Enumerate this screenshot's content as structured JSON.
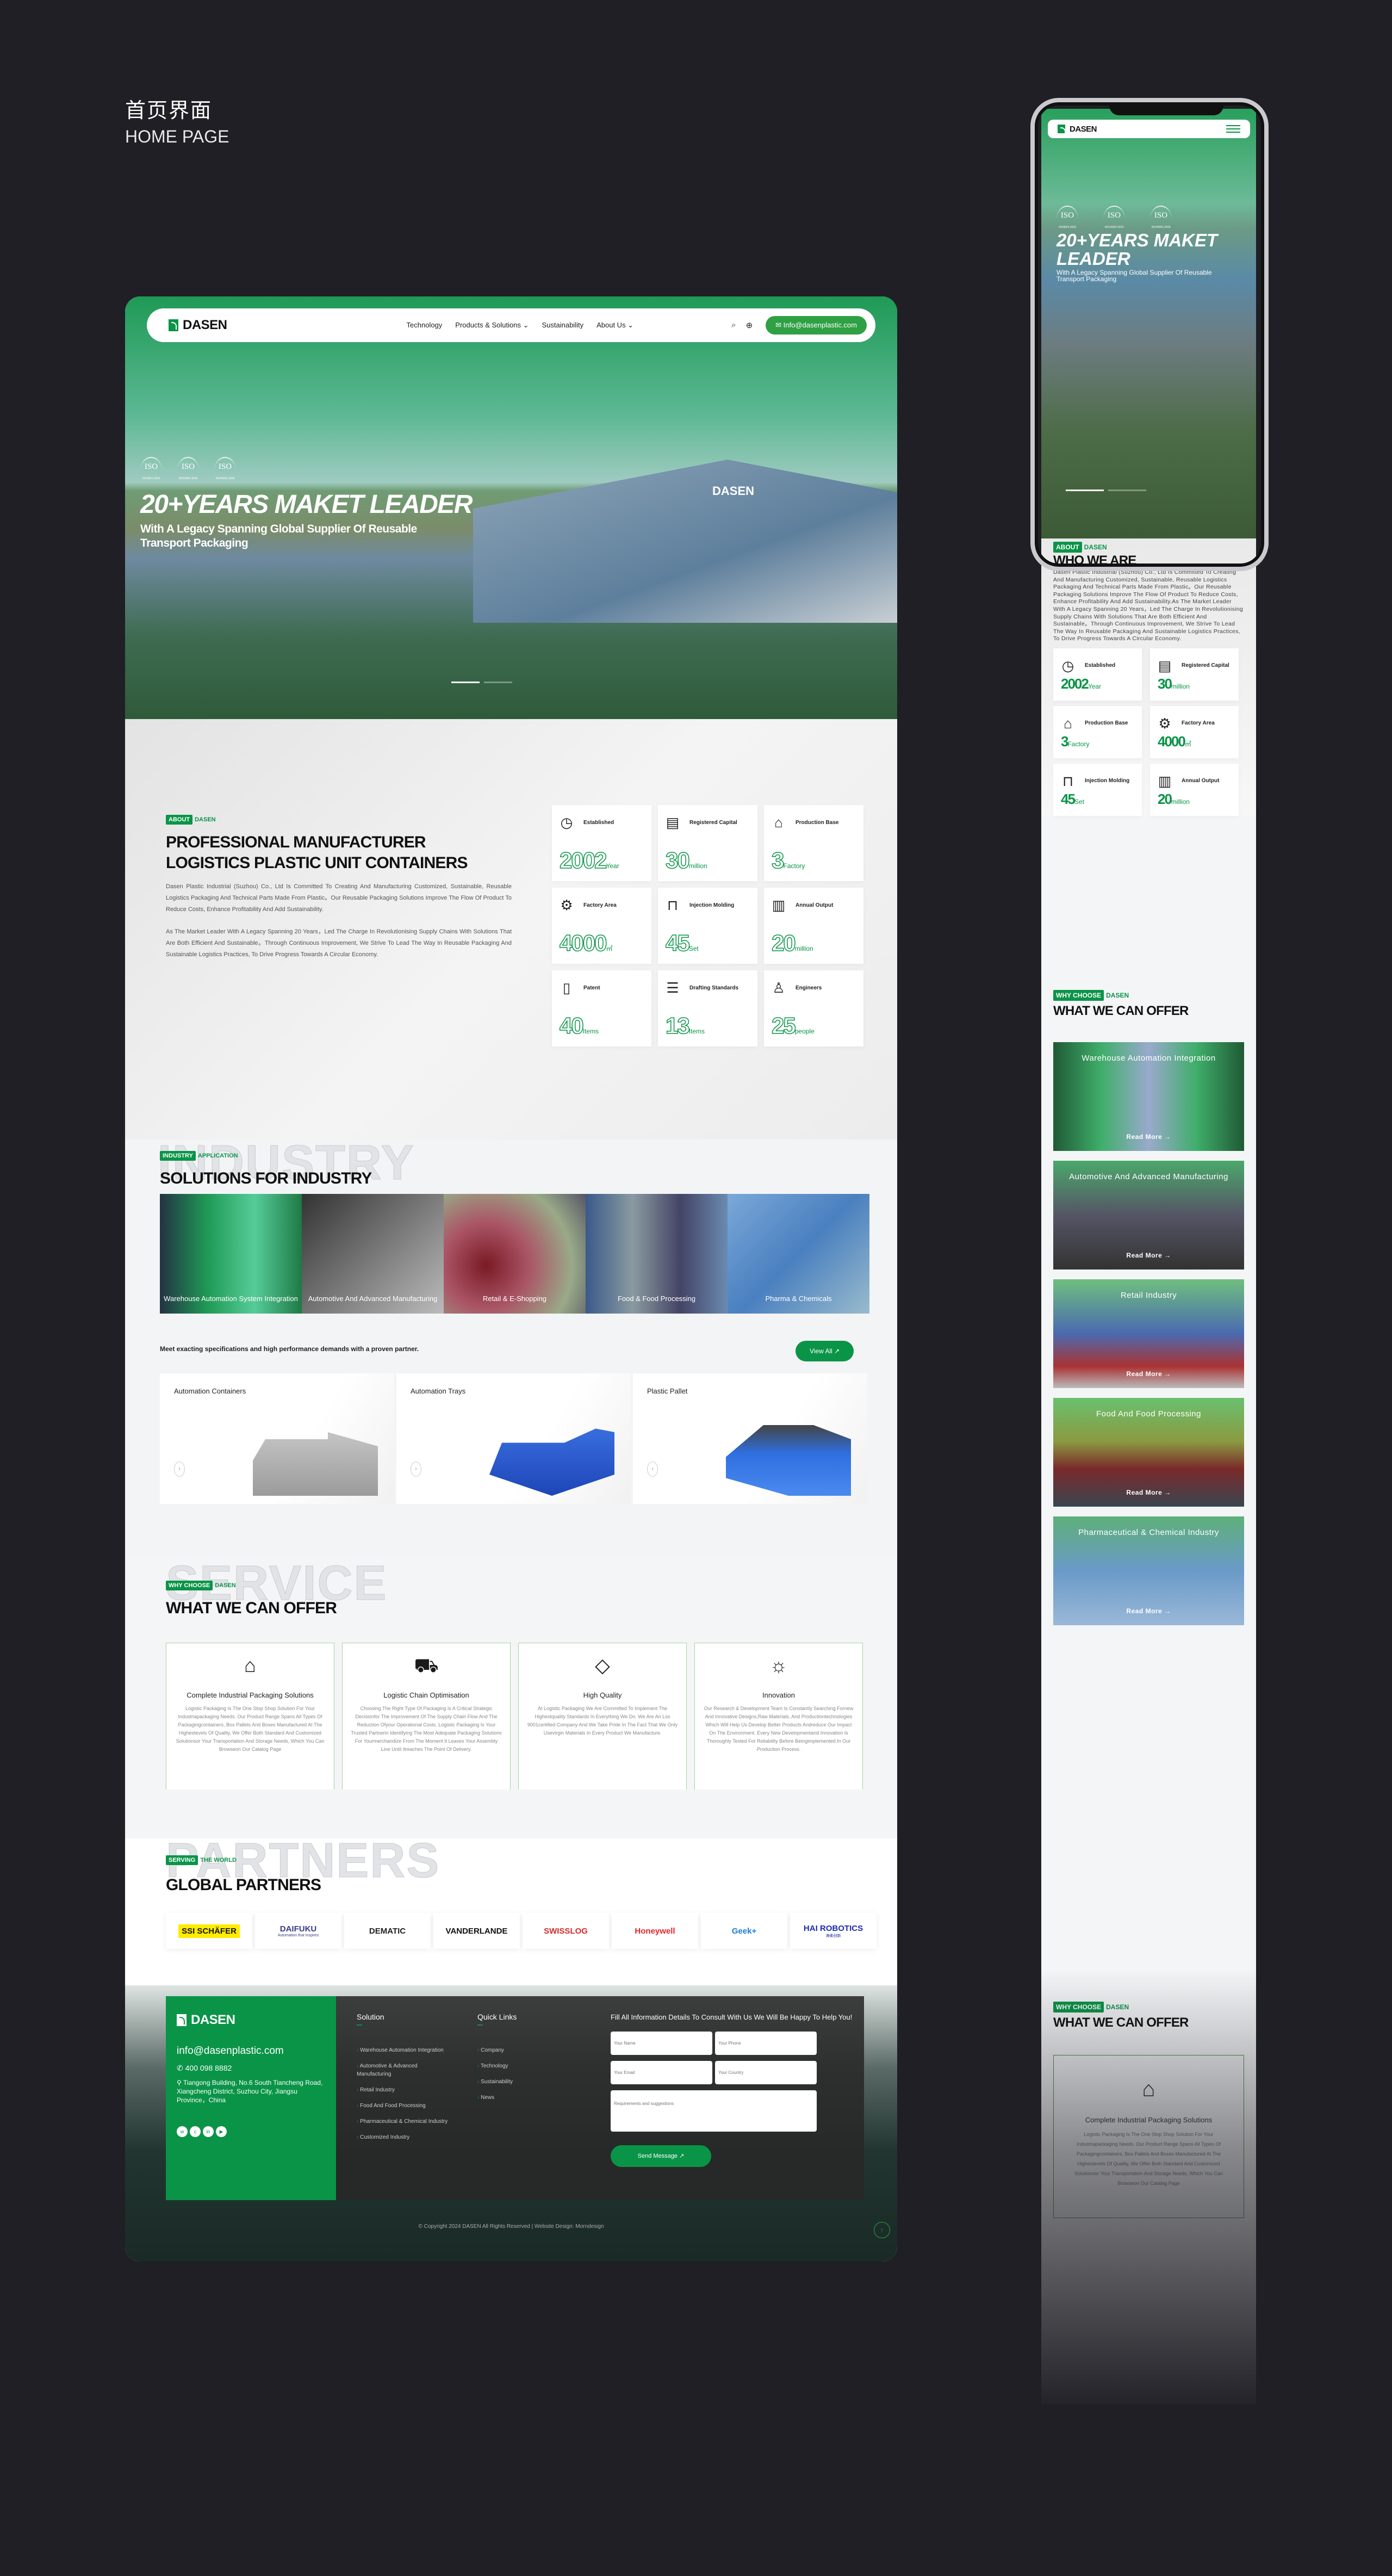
{
  "page": {
    "title_zh": "首页界面",
    "title_en": "HOME PAGE"
  },
  "brand": {
    "name": "DASEN",
    "green": "#0a9447"
  },
  "nav": {
    "links": [
      "Technology",
      "Products & Solutions ⌄",
      "Sustainability",
      "About Us ⌄"
    ],
    "search_icon": "search-icon",
    "globe_icon": "globe-icon",
    "email": "Info@dasenplastic.com"
  },
  "hero": {
    "iso": [
      "ISO",
      "ISO",
      "ISO"
    ],
    "iso_codes": [
      "ISO9001:2015",
      "ISO14001:2015",
      "ISO45001:2018"
    ],
    "title": "20+YEARS MAKET LEADER",
    "subtitle": "With A Legacy Spanning Global Supplier Of Reusable Transport Packaging",
    "building_sign": "DASEN"
  },
  "about": {
    "tag_a": "ABOUT",
    "tag_b": "DASEN",
    "ghost": "INDUSTRY",
    "title_1": "PROFESSIONAL MANUFACTURER",
    "title_2": "LOGISTICS PLASTIC UNIT CONTAINERS",
    "p1": "Dasen Plastic Industrial (Suzhou) Co., Ltd Is Committed To Creating And Manufacturing Customized, Sustainable, Reusable Logistics Packaging And Technical Parts Made From Plastic。Our Reusable Packaging Solutions Improve The Flow Of Product To Reduce Costs, Enhance Profitability And Add Sustainability.",
    "p2": "As The Market Leader With A Legacy Spanning 20 Years，Led The Charge In Revolutionising Supply Chains With Solutions That Are Both Efficient And Sustainable。Through Continuous Improvement, We Strive To Lead The Way In Reusable Packaging And Sustainable Logistics Practices, To Drive Progress Towards A Circular Economy.",
    "mobile_title": "WHO WE ARE",
    "mobile_text": "Dasen Plastic Industrial (Suzhou) Co., Ltd Is Committed To Creating And Manufacturing Customized, Sustainable, Reusable Logistics Packaging And Technical Parts Made From Plastic。Our Reusable Packaging Solutions Improve The Flow Of Product To Reduce Costs, Enhance Profitability And Add Sustainability.As The Market Leader With A Legacy Spanning 20 Years，Led The Charge In Revolutionising Supply Chains With Solutions That Are Both Efficient And Sustainable。Through Continuous Improvement, We Strive To Lead The Way In Reusable Packaging And Sustainable Logistics Practices, To Drive Progress Towards A Circular Economy.",
    "stats": [
      {
        "label": "Established",
        "value": "2002",
        "unit": "Year",
        "icon": "clock-icon"
      },
      {
        "label": "Registered Capital",
        "value": "30",
        "unit": "million",
        "icon": "document-stamp-icon"
      },
      {
        "label": "Production Base",
        "value": "3",
        "unit": "Factory",
        "icon": "factory-icon"
      },
      {
        "label": "Factory Area",
        "value": "4000",
        "unit": "㎡",
        "icon": "gears-icon"
      },
      {
        "label": "Injection Molding",
        "value": "45",
        "unit": "Set",
        "icon": "machine-icon"
      },
      {
        "label": "Annual Output",
        "value": "20",
        "unit": "million",
        "icon": "bar-chart-icon"
      },
      {
        "label": "Patent",
        "value": "40",
        "unit": "Items",
        "icon": "patent-icon"
      },
      {
        "label": "Drafting Standards",
        "value": "13",
        "unit": "Items",
        "icon": "standards-icon"
      },
      {
        "label": "Engineers",
        "value": "25",
        "unit": "people",
        "icon": "people-icon"
      }
    ]
  },
  "solutions": {
    "tag_a": "INDUSTRY",
    "tag_b": "APPLICATION",
    "ghost": "INDUSTRY",
    "title": "SOLUTIONS FOR INDUSTRY",
    "panels": [
      "Warehouse Automation System Integration",
      "Automotive And Advanced Manufacturing",
      "Retail & E-Shopping",
      "Food & Food Processing",
      "Pharma & Chemicals"
    ],
    "tagline": "Meet exacting specifications and high performance demands with a proven partner.",
    "view_all": "View All ↗",
    "products": [
      "Automation Containers",
      "Automation Trays",
      "Plastic Pallet"
    ]
  },
  "offer": {
    "tag_a": "WHY CHOOSE",
    "tag_b": "DASEN",
    "ghost": "SERVICE",
    "title": "WHAT WE CAN OFFER",
    "cards": [
      {
        "title": "Complete Industrial Packaging Solutions",
        "icon": "warehouse-icon",
        "text": "Logistic Packaging Is The One Stop Shop Solution For Your Industriapackaging Needs. Our Product Range Spans All Types Of Packagingcontainers, Box Pallets And Boxes Manufactured At The Highestevels Of Quality, We Offer Both Standard And Customized Solutionsor Your Transportation And Storage Needs, Which You Can Browseon Our Catalog Page"
      },
      {
        "title": "Logistic Chain Optimisation",
        "icon": "delivery-truck-icon",
        "text": "Choosing The Right Type Of Packaging Is A Critical Strategic Decisionfor The Improvement Of The Supply Chain Flow And The Reduction Ofyour Operational Costs. Logistic Packaging Is Your Trusted Partnerin Identifying The Most Adequate Packaging Solutions For Yourmerchandize From The Moment It Leaves Your Assembly Line Until Itreaches The Point Of Delivery."
      },
      {
        "title": "High Quality",
        "icon": "diamond-icon",
        "text": "At Logistic Packaging We Are Committed To Implement The Highestquality Standards In Everything We Do. We Are An Lso 9001certified Company And We Take Pride In The Fact That We Only Usevirgin Materials In Every Product We Manufacture."
      },
      {
        "title": "Innovation",
        "icon": "lightbulb-gear-icon",
        "text": "Our Research & Development Team Is Constantly Searching Fornew And Innovative Designs,Raw Materials, And Productiontechnologies Which Will Help Us Develop Better Products Andreduce Our Impact On The Environment. Every New Developmentand Innovation Is Thoroughly Tested For Reliability Before Beingimplemented In Our Production Process."
      }
    ],
    "mobile_cards": [
      "Warehouse Automation Integration",
      "Automotive And Advanced Manufacturing",
      "Retail Industry",
      "Food And Food Processing",
      "Pharmaceutical & Chemical Industry"
    ],
    "read_more": "Read More →"
  },
  "partners": {
    "tag_a": "SERVING",
    "tag_b": "THE WORLD",
    "ghost": "PARTNERS",
    "title": "GLOBAL PARTNERS",
    "logos": [
      {
        "name": "SSI SCHÄFER",
        "color": "#111"
      },
      {
        "name": "DAIFUKU",
        "sub": "Automation that Inspires",
        "color": "#3a3a8c"
      },
      {
        "name": "DEMATIC",
        "color": "#222"
      },
      {
        "name": "VANDERLANDE",
        "color": "#111"
      },
      {
        "name": "SWISSLOG",
        "color": "#d42a2a"
      },
      {
        "name": "Honeywell",
        "color": "#e4262c"
      },
      {
        "name": "Geek+",
        "color": "#1a7fd0"
      },
      {
        "name": "HAI ROBOTICS",
        "sub": "海柔创新",
        "color": "#1c2bb0"
      }
    ]
  },
  "footer": {
    "email": "info@dasenplastic.com",
    "phone": "400 098 8882",
    "address": "Tiangong Building, No.6 South Tiancheng Road, Xiangcheng District, Suzhou City, Jiangsu Province，China",
    "social": [
      "whatsapp-icon",
      "wechat-icon",
      "linkedin-icon",
      "youtube-icon"
    ],
    "solution_title": "Solution",
    "solution_links": [
      "Warehouse Automation Integration",
      "Automotive & Advanced Manufacturing",
      "Retail Industry",
      "Food And Food Processing",
      "Pharmaceutical & Chemical Industry",
      "Customized Industry"
    ],
    "quick_title": "Quick Links",
    "quick_links": [
      "Company",
      "Technology",
      "Sustainability",
      "News"
    ],
    "form_title": "Fill All Information Details To Consult With Us We Will Be Happy To Help You!",
    "placeholders": {
      "name": "Your Name",
      "phone": "Your Phone",
      "email": "Your Email",
      "country": "Your Country",
      "message": "Requirements and suggestions"
    },
    "send": "Send Message ↗",
    "copyright": "© Copyright 2024 DASEN All Rights Reserved | Website Design: Morndesign"
  }
}
